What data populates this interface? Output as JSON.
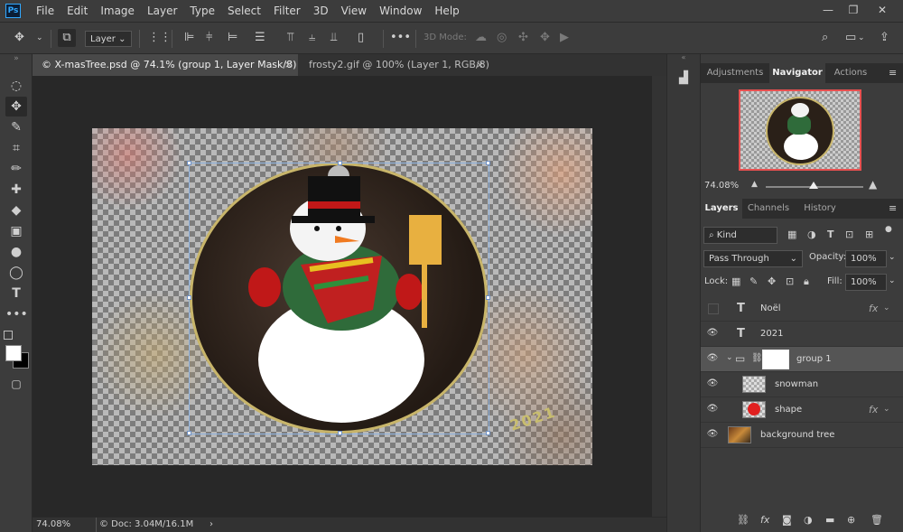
{
  "app": {
    "logo": "Ps"
  },
  "menu": [
    "File",
    "Edit",
    "Image",
    "Layer",
    "Type",
    "Select",
    "Filter",
    "3D",
    "View",
    "Window",
    "Help"
  ],
  "window_controls": {
    "restore": "⧉",
    "maximize": "❐",
    "close": "✕"
  },
  "options_bar": {
    "move_icon": "✥",
    "layer_dropdown": "Layer",
    "mode3d_label": "3D Mode:",
    "more": "•••"
  },
  "tabs": [
    {
      "label": "© X-masTree.psd @ 74.1% (group 1, Layer Mask/8) *",
      "close": "×"
    },
    {
      "label": "frosty2.gif @ 100% (Layer 1, RGB/8)",
      "close": "×"
    }
  ],
  "document": {
    "year_text": "2021"
  },
  "status": {
    "zoom": "74.08%",
    "doc_info": "© Doc: 3.04M/16.1M",
    "arrow": "›"
  },
  "panels": {
    "top_tabs": [
      "Adjustments",
      "Navigator",
      "Actions"
    ],
    "navigator": {
      "zoom": "74.08%"
    },
    "layer_tabs": [
      "Layers",
      "Channels",
      "History"
    ],
    "filter_kind": "Kind",
    "blend_mode": "Pass Through",
    "opacity_label": "Opacity:",
    "opacity_value": "100%",
    "lock_label": "Lock:",
    "fill_label": "Fill:",
    "fill_value": "100%",
    "layers": [
      {
        "name": "Noël",
        "kind": "T",
        "visible": false,
        "fx": "fx"
      },
      {
        "name": "2021",
        "kind": "T",
        "visible": true,
        "fx": ""
      },
      {
        "name": "group 1",
        "kind": "group",
        "visible": true,
        "fx": ""
      },
      {
        "name": "snowman",
        "kind": "image",
        "visible": true,
        "fx": ""
      },
      {
        "name": "shape",
        "kind": "image",
        "visible": true,
        "fx": "fx"
      },
      {
        "name": "background tree",
        "kind": "image",
        "visible": true,
        "fx": ""
      }
    ]
  },
  "colors": {
    "accent": "#31a8ff",
    "panel": "#3c3c3c",
    "canvas": "#282828",
    "ornament_ring": "#c8b56a",
    "shape_red": "#e02020"
  }
}
